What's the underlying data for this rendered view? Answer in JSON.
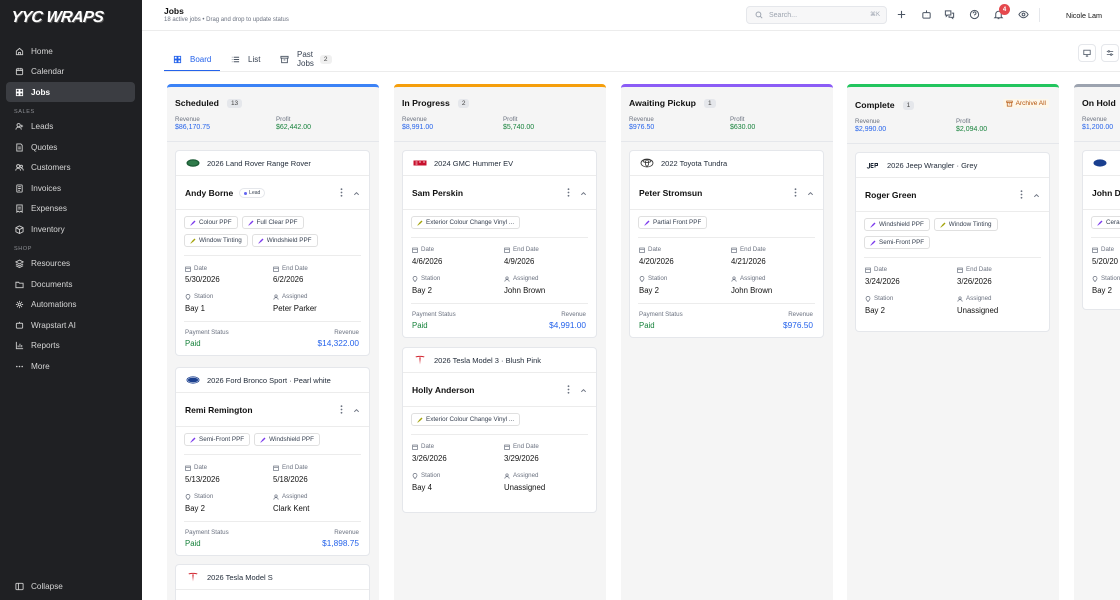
{
  "brand": {
    "logo_text": "YYC WRAPS"
  },
  "sidebar": {
    "items": [
      {
        "label": "Home",
        "icon": "home-icon"
      },
      {
        "label": "Calendar",
        "icon": "calendar-icon"
      },
      {
        "label": "Jobs",
        "icon": "board-icon",
        "active": true
      }
    ],
    "sales_title": "SALES",
    "sales_items": [
      {
        "label": "Leads",
        "icon": "user-plus-icon"
      },
      {
        "label": "Quotes",
        "icon": "document-icon"
      },
      {
        "label": "Customers",
        "icon": "users-icon"
      },
      {
        "label": "Invoices",
        "icon": "invoice-icon"
      },
      {
        "label": "Expenses",
        "icon": "receipt-icon"
      },
      {
        "label": "Inventory",
        "icon": "box-icon"
      }
    ],
    "shop_title": "SHOP",
    "shop_items": [
      {
        "label": "Resources",
        "icon": "layers-icon"
      },
      {
        "label": "Documents",
        "icon": "folder-icon"
      },
      {
        "label": "Automations",
        "icon": "automation-icon"
      },
      {
        "label": "Wrapstart AI",
        "icon": "sparkle-icon"
      },
      {
        "label": "Reports",
        "icon": "chart-icon"
      },
      {
        "label": "More",
        "icon": "ellipsis-icon"
      }
    ],
    "collapse_label": "Collapse"
  },
  "header": {
    "title": "Jobs",
    "subtitle": "18 active jobs • Drag and drop to update status",
    "search_placeholder": "Search...",
    "search_shortcut": "⌘K",
    "notification_count": "4",
    "user_name": "Nicole Lam"
  },
  "tabs": [
    {
      "label": "Board",
      "icon": "board-icon"
    },
    {
      "label": "List",
      "icon": "list-icon"
    },
    {
      "label": "Past Jobs",
      "icon": "archive-icon",
      "count": "2"
    }
  ],
  "labels": {
    "revenue": "Revenue",
    "profit": "Profit",
    "date": "Date",
    "end_date": "End Date",
    "station": "Station",
    "assigned": "Assigned",
    "payment_status": "Payment Status",
    "archive_all": "Archive All",
    "lead": "Lead"
  },
  "columns": [
    {
      "title": "Scheduled",
      "count": "13",
      "accent": "#3b82f6",
      "revenue": "$86,170.75",
      "profit": "$62,442.00",
      "cards": [
        {
          "vehicle": "2026 Land Rover Range Rover",
          "brand": "land-rover-logo-icon",
          "customer": "Andy Borne",
          "lead": true,
          "tags": [
            "Colour PPF",
            "Full Clear PPF",
            "Window Tinting",
            "Windshield PPF"
          ],
          "date": "5/30/2026",
          "end_date": "6/2/2026",
          "station": "Bay 1",
          "assigned": "Peter Parker",
          "payment": "Paid",
          "revenue": "$14,322.00"
        },
        {
          "vehicle": "2026 Ford Bronco Sport · Pearl white",
          "brand": "ford-logo-icon",
          "customer": "Remi Remington",
          "tags": [
            "Semi-Front PPF",
            "Windshield PPF"
          ],
          "date": "5/13/2026",
          "end_date": "5/18/2026",
          "station": "Bay 2",
          "assigned": "Clark Kent",
          "payment": "Paid",
          "revenue": "$1,898.75"
        },
        {
          "vehicle": "2026 Tesla Model S",
          "brand": "tesla-logo-icon"
        }
      ]
    },
    {
      "title": "In Progress",
      "count": "2",
      "accent": "#f59e0b",
      "revenue": "$8,991.00",
      "profit": "$5,740.00",
      "cards": [
        {
          "vehicle": "2024 GMC Hummer EV",
          "brand": "gmc-logo-icon",
          "customer": "Sam Perskin",
          "tags": [
            "Exterior Colour Change Vinyl ..."
          ],
          "date": "4/6/2026",
          "end_date": "4/9/2026",
          "station": "Bay 2",
          "assigned": "John Brown",
          "payment": "Paid",
          "revenue": "$4,991.00"
        },
        {
          "vehicle": "2026 Tesla Model 3 · Blush Pink",
          "brand": "tesla-logo-icon",
          "customer": "Holly Anderson",
          "tags": [
            "Exterior Colour Change Vinyl ..."
          ],
          "date": "3/26/2026",
          "end_date": "3/29/2026",
          "station": "Bay 4",
          "assigned": "Unassigned"
        }
      ]
    },
    {
      "title": "Awaiting Pickup",
      "count": "1",
      "accent": "#8b5cf6",
      "revenue": "$976.50",
      "profit": "$630.00",
      "cards": [
        {
          "vehicle": "2022 Toyota Tundra",
          "brand": "toyota-logo-icon",
          "customer": "Peter Stromsun",
          "tags": [
            "Partial Front PPF"
          ],
          "date": "4/20/2026",
          "end_date": "4/21/2026",
          "station": "Bay 2",
          "assigned": "John Brown",
          "payment": "Paid",
          "revenue": "$976.50"
        }
      ]
    },
    {
      "title": "Complete",
      "count": "1",
      "accent": "#22c55e",
      "revenue": "$2,990.00",
      "profit": "$2,094.00",
      "cards": [
        {
          "vehicle": "2026 Jeep Wrangler · Grey",
          "brand": "jeep-logo-icon",
          "customer": "Roger Green",
          "tags": [
            "Windshield PPF",
            "Window Tinting",
            "Semi-Front PPF"
          ],
          "date": "3/24/2026",
          "end_date": "3/26/2026",
          "station": "Bay 2",
          "assigned": "Unassigned"
        }
      ]
    },
    {
      "title": "On Hold",
      "accent": "#9ca3af",
      "revenue": "$1,200.00",
      "cards": [
        {
          "brand": "ford-logo-icon",
          "customer": "John D",
          "tag_partial": "Cera",
          "date": "5/20/20",
          "station": "Bay 2"
        }
      ]
    }
  ],
  "colors": {
    "primary": "#2563eb",
    "paid": "#16823b",
    "sidebar_bg": "#1f2023",
    "notification": "#e5484d"
  }
}
